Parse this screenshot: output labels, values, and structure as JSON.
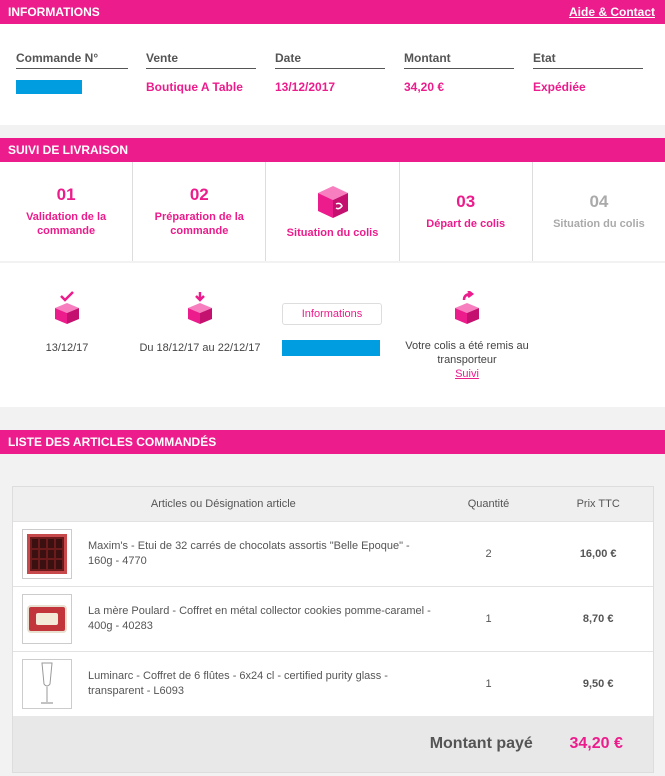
{
  "info": {
    "title": "INFORMATIONS",
    "help_link": "Aide & Contact",
    "columns": [
      {
        "header": "Commande N°",
        "value": ""
      },
      {
        "header": "Vente",
        "value": "Boutique A Table"
      },
      {
        "header": "Date",
        "value": "13/12/2017"
      },
      {
        "header": "Montant",
        "value": "34,20 €"
      },
      {
        "header": "Etat",
        "value": "Expédiée"
      }
    ]
  },
  "suivi": {
    "title": "SUIVI DE LIVRAISON",
    "steps": [
      {
        "num": "01",
        "label": "Validation de la commande"
      },
      {
        "num": "02",
        "label": "Préparation de la commande"
      },
      {
        "num": "",
        "label": "Situation du colis"
      },
      {
        "num": "03",
        "label": "Départ de colis"
      },
      {
        "num": "04",
        "label": "Situation du colis"
      }
    ],
    "timeline": {
      "date1": "13/12/17",
      "date2": "Du 18/12/17 au 22/12/17",
      "info_button": "Informations",
      "shipped_text": "Votre colis a été remis au transporteur",
      "track_link": "Suivi"
    }
  },
  "articles": {
    "title": "LISTE DES ARTICLES COMMANDÉS",
    "headers": {
      "designation": "Articles ou Désignation article",
      "qty": "Quantité",
      "price": "Prix TTC"
    },
    "rows": [
      {
        "desc": "Maxim's - Etui de 32 carrés de chocolats assortis \"Belle Epoque\" - 160g - 4770",
        "qty": "2",
        "price": "16,00 €"
      },
      {
        "desc": "La mère Poulard - Coffret en métal collector cookies pomme-caramel - 400g - 40283",
        "qty": "1",
        "price": "8,70 €"
      },
      {
        "desc": "Luminarc - Coffret de 6 flûtes - 6x24 cl - certified purity glass - transparent - L6093",
        "qty": "1",
        "price": "9,50 €"
      }
    ],
    "total_label": "Montant payé",
    "total_value": "34,20 €"
  },
  "colors": {
    "accent": "#ec1c8c",
    "redaction": "#009ee0"
  }
}
